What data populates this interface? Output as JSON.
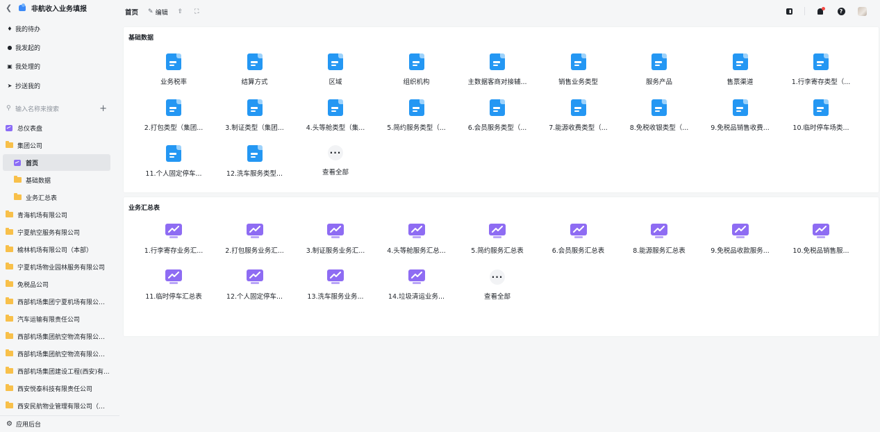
{
  "app": {
    "title": "非航收入业务填报"
  },
  "sidebar": {
    "quick": [
      {
        "label": "我的待办",
        "icon": "bell-icon"
      },
      {
        "label": "我发起的",
        "icon": "send-icon"
      },
      {
        "label": "我处理的",
        "icon": "briefcase-icon"
      },
      {
        "label": "抄送我的",
        "icon": "paper-plane-icon"
      }
    ],
    "search_placeholder": "输入名称来搜索",
    "tree": [
      {
        "label": "总仪表盘",
        "type": "dashboard",
        "indent": 0
      },
      {
        "label": "集团公司",
        "type": "folder",
        "indent": 0
      },
      {
        "label": "首页",
        "type": "dashboard",
        "indent": 1,
        "active": true
      },
      {
        "label": "基础数据",
        "type": "folder",
        "indent": 1
      },
      {
        "label": "业务汇总表",
        "type": "folder",
        "indent": 1
      },
      {
        "label": "青海机场有限公司",
        "type": "folder",
        "indent": 0
      },
      {
        "label": "宁夏航空服务有限公司",
        "type": "folder",
        "indent": 0
      },
      {
        "label": "榆林机场有限公司（本部）",
        "type": "folder",
        "indent": 0
      },
      {
        "label": "宁夏机场物业园林服务有限公司",
        "type": "folder",
        "indent": 0
      },
      {
        "label": "免税品公司",
        "type": "folder",
        "indent": 0
      },
      {
        "label": "西部机场集团宁夏机场有限公司...",
        "type": "folder",
        "indent": 0
      },
      {
        "label": "汽车运输有限责任公司",
        "type": "folder",
        "indent": 0
      },
      {
        "label": "西部机场集团航空物流有限公司...",
        "type": "folder",
        "indent": 0
      },
      {
        "label": "西部机场集团航空物流有限公司...",
        "type": "folder",
        "indent": 0
      },
      {
        "label": "西部机场集团建设工程(西安)有...",
        "type": "folder",
        "indent": 0
      },
      {
        "label": "西安悦泰科技有限责任公司",
        "type": "folder",
        "indent": 0
      },
      {
        "label": "西安民航物业管理有限公司（本...",
        "type": "folder",
        "indent": 0
      }
    ],
    "footer_label": "应用后台"
  },
  "topbar": {
    "breadcrumb": "首页",
    "edit_label": "编辑"
  },
  "sections": [
    {
      "title": "基础数据",
      "icon": "document-icon",
      "items": [
        "业务税率",
        "结算方式",
        "区域",
        "组织机构",
        "主数据客商对接辅...",
        "销售业务类型",
        "服务产品",
        "售票渠道",
        "1.行李寄存类型（...",
        "2.打包类型（集团...",
        "3.制证类型（集团...",
        "4.头等舱类型（集...",
        "5.简约服务类型（...",
        "6.会员服务类型（...",
        "7.能源收费类型（...",
        "8.免税收银类型（...",
        "9.免税品销售收费...",
        "10.临时停车场类...",
        "11.个人固定停车...",
        "12.洗车服务类型..."
      ],
      "view_all": "查看全部"
    },
    {
      "title": "业务汇总表",
      "icon": "chart-monitor-icon",
      "items": [
        "1.行李寄存业务汇...",
        "2.打包服务业务汇...",
        "3.制证服务业务汇...",
        "4.头等舱服务汇总...",
        "5.简约服务汇总表",
        "6.会员服务汇总表",
        "8.能源服务汇总表",
        "9.免税品收款服务...",
        "10.免税品销售服...",
        "11.临时停车汇总表",
        "12.个人固定停车...",
        "13.洗车服务业务...",
        "14.垃圾清运业务..."
      ],
      "view_all": "查看全部"
    }
  ]
}
